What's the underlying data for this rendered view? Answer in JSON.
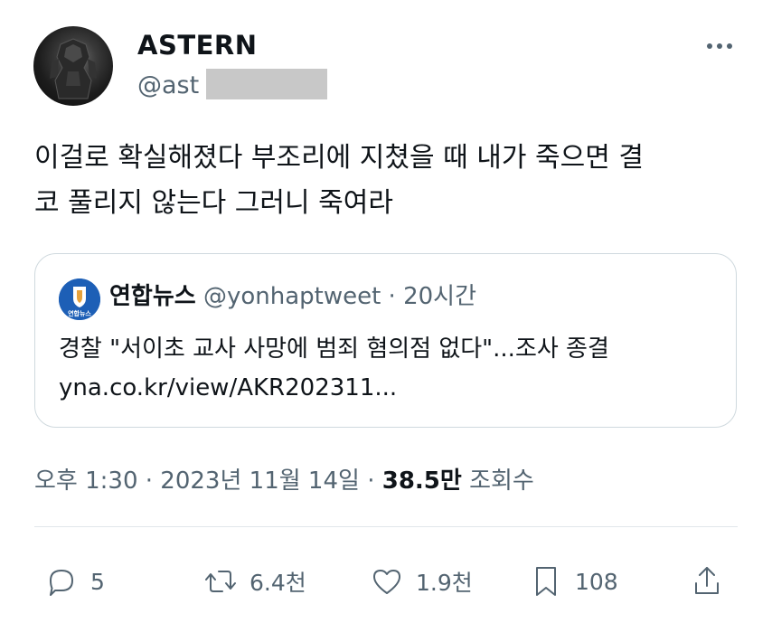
{
  "author": {
    "display_name": "ASTERN",
    "handle_visible": "@ast"
  },
  "tweet": {
    "text_lines": [
      "이걸로 확실해졌다 부조리에 지쳤을 때 내가 죽으면 결",
      "코 풀리지 않는다 그러니 죽여라"
    ]
  },
  "quote": {
    "avatar_text": "연합뉴스",
    "name": "연합뉴스",
    "handle": "@yonhaptweet",
    "separator": " · ",
    "time": "20시간",
    "text": "경찰 \"서이초 교사 사망에 범죄 혐의점 없다\"...조사 종결",
    "link": "yna.co.kr/view/AKR202311..."
  },
  "meta": {
    "time": "오후 1:30",
    "separator": " · ",
    "date": "2023년 11월 14일",
    "views_count": "38.5만",
    "views_label": "조회수"
  },
  "actions": {
    "replies": "5",
    "retweets": "6.4천",
    "likes": "1.9천",
    "bookmarks": "108"
  },
  "icons": {
    "more": "more-icon",
    "reply": "reply-icon",
    "retweet": "retweet-icon",
    "like": "heart-icon",
    "bookmark": "bookmark-icon",
    "share": "share-icon"
  },
  "colors": {
    "text": "#0f1419",
    "secondary": "#536471",
    "border": "#cfd9de",
    "quote_avatar": "#1d5fb6"
  }
}
